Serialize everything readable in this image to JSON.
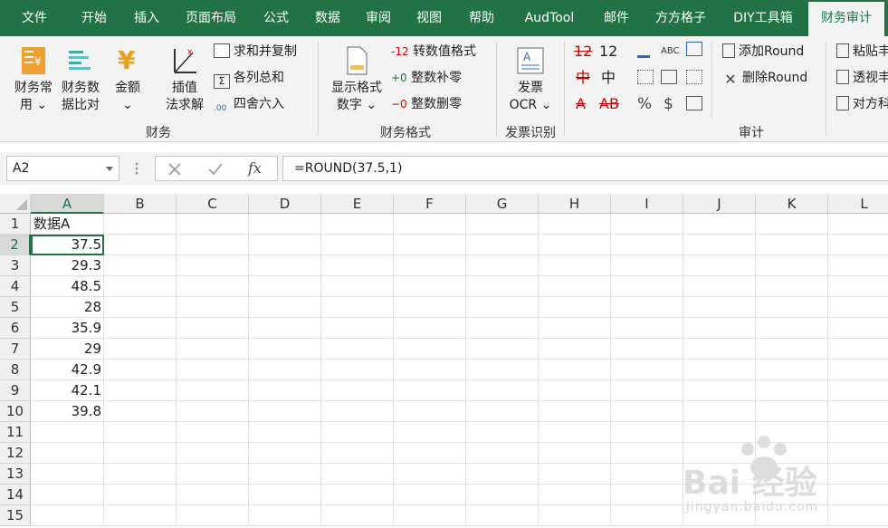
{
  "ribbon_tabs": [
    "文件",
    "开始",
    "插入",
    "页面布局",
    "公式",
    "数据",
    "审阅",
    "视图",
    "帮助",
    "AudTool",
    "邮件",
    "方方格子",
    "DIY工具箱",
    "财务审计"
  ],
  "active_tab": "财务审计",
  "colors": {
    "accent": "#217346",
    "ribbon_bg": "#f3f3f3"
  },
  "groups": {
    "finance": {
      "label": "财务",
      "buttons": [
        {
          "line1": "财务常",
          "line2": "用 ⌄",
          "icon": "ledger-icon"
        },
        {
          "line1": "财务数",
          "line2": "据比对",
          "icon": "compare-icon"
        },
        {
          "line1": "金额",
          "line2": "⌄",
          "icon": "yen-icon"
        },
        {
          "line1": "插值",
          "line2": "法求解",
          "icon": "interpolate-icon"
        }
      ],
      "small": [
        "求和并复制",
        "各列总和",
        "四舍六入"
      ]
    },
    "format": {
      "label": "财务格式",
      "big": {
        "line1": "显示格式",
        "line2": "数字 ⌄"
      },
      "small_prefix": [
        "-12",
        "+0",
        "−0"
      ],
      "small": [
        "转数值格式",
        "整数补零",
        "整数删零"
      ]
    },
    "invoice": {
      "label": "发票识别",
      "big": {
        "line1": "发票",
        "line2": "OCR ⌄"
      }
    },
    "audit": {
      "label": "审计",
      "glyphs": [
        "12",
        "12",
        "中",
        "中",
        "A",
        "AB",
        "%",
        "$",
        "ABC"
      ],
      "small": [
        "添加Round",
        "删除Round"
      ],
      "right": [
        "粘贴丰",
        "透视丰",
        "对方科"
      ]
    }
  },
  "namebox": "A2",
  "formula": "=ROUND(37.5,1)",
  "columns": [
    "A",
    "B",
    "C",
    "D",
    "E",
    "F",
    "G",
    "H",
    "I",
    "J",
    "K",
    "L"
  ],
  "rows": [
    "1",
    "2",
    "3",
    "4",
    "5",
    "6",
    "7",
    "8",
    "9",
    "10",
    "11",
    "12",
    "13",
    "14",
    "15"
  ],
  "cells": {
    "header": "数据A",
    "values": [
      "37.5",
      "29.3",
      "48.5",
      "28",
      "35.9",
      "29",
      "42.9",
      "42.1",
      "39.8"
    ]
  },
  "watermark": {
    "brand": "Bai 经验",
    "url": "jingyan.baidu.com"
  }
}
